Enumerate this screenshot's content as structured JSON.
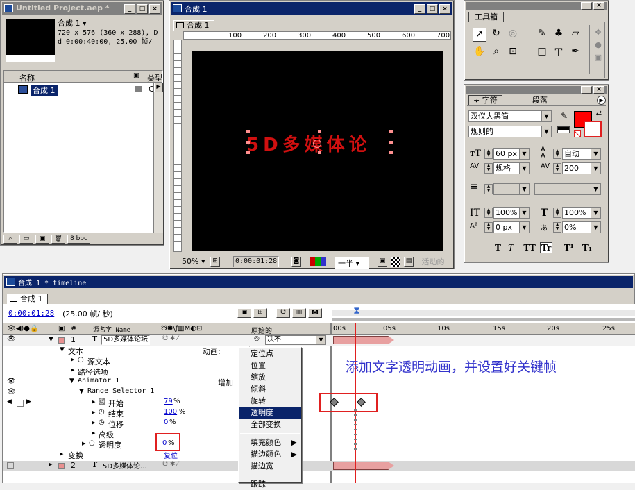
{
  "project": {
    "title": "Untitled Project.aep *",
    "comp_name": "合成 1",
    "comp_info_line1": "720 x 576  (360 x 288), D",
    "comp_info_line2": "d 0:00:40:00, 25.00 帧/",
    "col_name": "名称",
    "col_type": "类型",
    "item_name": "合成 1",
    "item_type": "C",
    "bpc": "8 bpc"
  },
  "comp_viewer": {
    "title": "合成 1",
    "tab": "合成 1",
    "ruler_ticks": [
      "100",
      "200",
      "300",
      "400",
      "500",
      "600",
      "700"
    ],
    "canvas_text": "5D多媒体论",
    "zoom": "50%",
    "timecode": "0:00:01:28",
    "resolution": "一半",
    "activate": "活动的"
  },
  "toolbox": {
    "title": "工具箱"
  },
  "character": {
    "tab_char": "字符",
    "tab_para": "段落",
    "font": "汉仪大黑简",
    "style": "规则的",
    "size": "60 px",
    "leading": "自动",
    "kerning": "规格",
    "tracking": "200",
    "vscale": "100%",
    "hscale": "100%",
    "baseline": "0 px",
    "tsume": "0%",
    "fill_color": "#ff0000",
    "style_buttons": [
      "T",
      "T",
      "TT",
      "Tr",
      "T¹",
      "T₁"
    ]
  },
  "timeline": {
    "title": "合成 1 * timeline",
    "tab": "合成 1",
    "timecode": "0:00:01:28",
    "fps": "(25.00 帧/ 秒)",
    "col_hash": "#",
    "col_source": "源名字 Name",
    "col_parent": "原始的",
    "time_ticks": [
      "00s",
      "05s",
      "10s",
      "15s",
      "20s",
      "25s"
    ],
    "layer1_num": "1",
    "layer1_name": "5D多媒体论坛",
    "layer1_parent": "决不",
    "text_group": "文本",
    "animate_label": "动画:",
    "source_text": "源文本",
    "path_options": "路径选项",
    "animator": "Animator 1",
    "add_label": "增加",
    "range_selector": "Range Selector 1",
    "start_label": "开始",
    "start_value": "79",
    "end_label": "结束",
    "end_value": "100",
    "offset_label": "位移",
    "offset_value": "0",
    "advanced": "高级",
    "opacity_label": "透明度",
    "opacity_value": "0",
    "percent": "%",
    "transform": "变换",
    "reset": "复位",
    "layer2_num": "2",
    "layer2_name": "5D多媒体论...",
    "annotation": "添加文字透明动画，并设置好关键帧"
  },
  "context_menu": {
    "items": [
      "定位点",
      "位置",
      "缩放",
      "倾斜",
      "旋转",
      "透明度",
      "全部变换"
    ],
    "items2": [
      "填充颜色",
      "描边颜色",
      "描边宽"
    ],
    "last": "跟踪"
  },
  "colors": {
    "accent_red": "#e02020",
    "selection": "#0a246a",
    "annotation_blue": "#3333cc"
  }
}
